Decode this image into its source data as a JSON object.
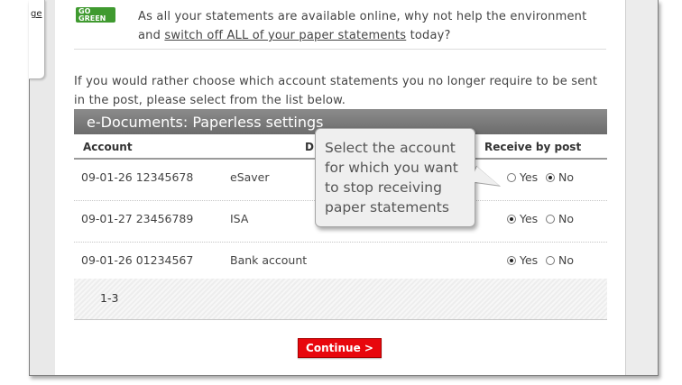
{
  "side_tab": {
    "label": "ge"
  },
  "badge": {
    "line1": "GO",
    "line2": "GREEN"
  },
  "top_message": {
    "line1": "As all your statements are available online, why not help the environment",
    "line2_prefix": "and ",
    "link": "switch off ALL of your paper statements",
    "line2_suffix": " today?"
  },
  "intro": "If you would rather choose which account statements you no longer require to be sent in the post, please select from the list below.",
  "table": {
    "title": "e-Documents: Paperless settings",
    "columns": {
      "account": "Account",
      "description": "D",
      "receive": "Receive by post"
    },
    "rows": [
      {
        "account": "09-01-26 12345678",
        "type": "eSaver",
        "yes": "Yes",
        "no": "No",
        "selected": "No"
      },
      {
        "account": "09-01-27 23456789",
        "type": "ISA",
        "yes": "Yes",
        "no": "No",
        "selected": "Yes"
      },
      {
        "account": "09-01-26 01234567",
        "type": "Bank account",
        "yes": "Yes",
        "no": "No",
        "selected": "Yes"
      }
    ]
  },
  "pager": {
    "range": "1-3"
  },
  "continue_button": "Continue >",
  "tooltip": "Select the account for which you want to stop receiving paper statements",
  "colors": {
    "accent_red": "#e8070d",
    "header_grey": "#7a7a7a",
    "green_badge": "#3f9a2f"
  }
}
